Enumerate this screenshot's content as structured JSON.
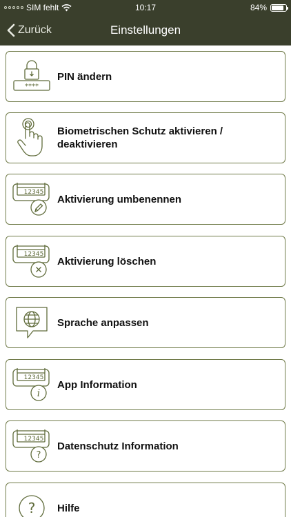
{
  "status_bar": {
    "carrier": "SIM fehlt",
    "time": "10:17",
    "battery_percent": "84%",
    "battery_level": 0.84
  },
  "nav": {
    "back_label": "Zurück",
    "title": "Einstellungen"
  },
  "colors": {
    "bar_background": "#3a3f2c",
    "card_border": "#6f7a48",
    "icon_stroke": "#5f6b3a"
  },
  "menu": {
    "items": [
      {
        "label": "PIN ändern",
        "icon": "pin-lock-icon"
      },
      {
        "label": "Biometrischen Schutz aktivieren / deaktivieren",
        "icon": "touch-hand-icon"
      },
      {
        "label": "Aktivierung umbenennen",
        "icon": "token-rename-icon",
        "token_text": "12345"
      },
      {
        "label": "Aktivierung löschen",
        "icon": "token-delete-icon",
        "token_text": "12345"
      },
      {
        "label": "Sprache anpassen",
        "icon": "globe-speech-icon"
      },
      {
        "label": "App Information",
        "icon": "token-info-icon",
        "token_text": "12345"
      },
      {
        "label": "Datenschutz Information",
        "icon": "token-privacy-icon",
        "token_text": "12345"
      },
      {
        "label": "Hilfe",
        "icon": "help-icon"
      }
    ]
  }
}
